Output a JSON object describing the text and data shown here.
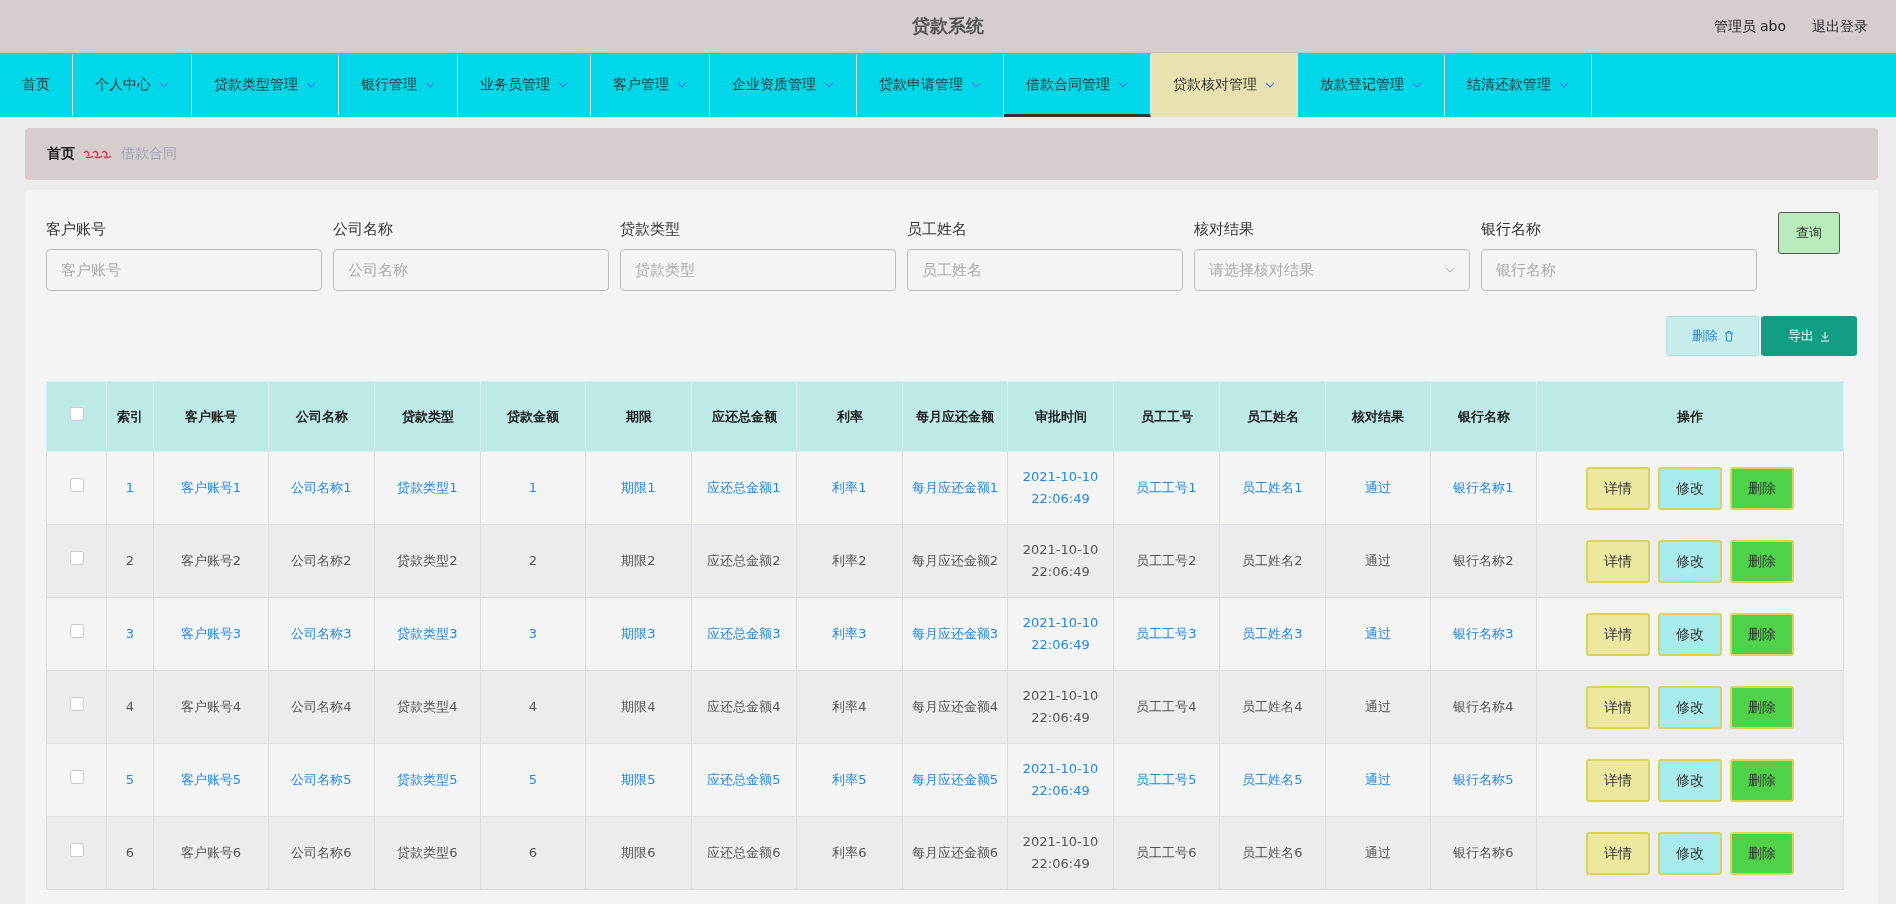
{
  "header": {
    "title": "贷款系统",
    "user": "管理员 abo",
    "logout": "退出登录"
  },
  "nav": [
    {
      "label": "首页",
      "dropdown": false,
      "selected": false,
      "hovered": false
    },
    {
      "label": "个人中心",
      "dropdown": true,
      "selected": false,
      "hovered": false
    },
    {
      "label": "贷款类型管理",
      "dropdown": true,
      "selected": false,
      "hovered": false
    },
    {
      "label": "银行管理",
      "dropdown": true,
      "selected": false,
      "hovered": false
    },
    {
      "label": "业务员管理",
      "dropdown": true,
      "selected": false,
      "hovered": false
    },
    {
      "label": "客户管理",
      "dropdown": true,
      "selected": false,
      "hovered": false
    },
    {
      "label": "企业资质管理",
      "dropdown": true,
      "selected": false,
      "hovered": false
    },
    {
      "label": "贷款申请管理",
      "dropdown": true,
      "selected": false,
      "hovered": false
    },
    {
      "label": "借款合同管理",
      "dropdown": true,
      "selected": true,
      "hovered": false
    },
    {
      "label": "贷款核对管理",
      "dropdown": true,
      "selected": false,
      "hovered": true
    },
    {
      "label": "放款登记管理",
      "dropdown": true,
      "selected": false,
      "hovered": false
    },
    {
      "label": "结清还款管理",
      "dropdown": true,
      "selected": false,
      "hovered": false
    }
  ],
  "breadcrumb": {
    "home": "首页",
    "current": "借款合同"
  },
  "filters": [
    {
      "label": "客户账号",
      "placeholder": "客户账号",
      "kind": "text"
    },
    {
      "label": "公司名称",
      "placeholder": "公司名称",
      "kind": "text"
    },
    {
      "label": "贷款类型",
      "placeholder": "贷款类型",
      "kind": "text"
    },
    {
      "label": "员工姓名",
      "placeholder": "员工姓名",
      "kind": "text"
    },
    {
      "label": "核对结果",
      "placeholder": "请选择核对结果",
      "kind": "select"
    },
    {
      "label": "银行名称",
      "placeholder": "银行名称",
      "kind": "text"
    }
  ],
  "search_button": "查询",
  "toolbar": {
    "delete": "删除",
    "export": "导出"
  },
  "table": {
    "select_all_checked": false,
    "columns": [
      "索引",
      "客户账号",
      "公司名称",
      "贷款类型",
      "贷款金额",
      "期限",
      "应还总金额",
      "利率",
      "每月应还金额",
      "审批时间",
      "员工工号",
      "员工姓名",
      "核对结果",
      "银行名称",
      "操作"
    ],
    "rows": [
      {
        "kind": "link",
        "checked": false,
        "cells": [
          "1",
          "客户账号1",
          "公司名称1",
          "贷款类型1",
          "1",
          "期限1",
          "应还总金额1",
          "利率1",
          "每月应还金额1",
          "2021-10-10 22:06:49",
          "员工工号1",
          "员工姓名1",
          "通过",
          "银行名称1"
        ],
        "actions": [
          {
            "label": "详情",
            "kind": "detail"
          },
          {
            "label": "修改",
            "kind": "edit"
          },
          {
            "label": "删除",
            "kind": "delete"
          }
        ]
      },
      {
        "kind": "plain",
        "checked": false,
        "cells": [
          "2",
          "客户账号2",
          "公司名称2",
          "贷款类型2",
          "2",
          "期限2",
          "应还总金额2",
          "利率2",
          "每月应还金额2",
          "2021-10-10 22:06:49",
          "员工工号2",
          "员工姓名2",
          "通过",
          "银行名称2"
        ],
        "actions": [
          {
            "label": "详情",
            "kind": "detail"
          },
          {
            "label": "修改",
            "kind": "edit"
          },
          {
            "label": "删除",
            "kind": "delete"
          }
        ]
      },
      {
        "kind": "link",
        "checked": false,
        "cells": [
          "3",
          "客户账号3",
          "公司名称3",
          "贷款类型3",
          "3",
          "期限3",
          "应还总金额3",
          "利率3",
          "每月应还金额3",
          "2021-10-10 22:06:49",
          "员工工号3",
          "员工姓名3",
          "通过",
          "银行名称3"
        ],
        "actions": [
          {
            "label": "详情",
            "kind": "detail"
          },
          {
            "label": "修改",
            "kind": "edit"
          },
          {
            "label": "删除",
            "kind": "delete"
          }
        ]
      },
      {
        "kind": "plain",
        "checked": false,
        "cells": [
          "4",
          "客户账号4",
          "公司名称4",
          "贷款类型4",
          "4",
          "期限4",
          "应还总金额4",
          "利率4",
          "每月应还金额4",
          "2021-10-10 22:06:49",
          "员工工号4",
          "员工姓名4",
          "通过",
          "银行名称4"
        ],
        "actions": [
          {
            "label": "详情",
            "kind": "detail"
          },
          {
            "label": "修改",
            "kind": "edit"
          },
          {
            "label": "删除",
            "kind": "delete"
          }
        ]
      },
      {
        "kind": "link",
        "checked": false,
        "cells": [
          "5",
          "客户账号5",
          "公司名称5",
          "贷款类型5",
          "5",
          "期限5",
          "应还总金额5",
          "利率5",
          "每月应还金额5",
          "2021-10-10 22:06:49",
          "员工工号5",
          "员工姓名5",
          "通过",
          "银行名称5"
        ],
        "actions": [
          {
            "label": "详情",
            "kind": "detail"
          },
          {
            "label": "修改",
            "kind": "edit"
          },
          {
            "label": "删除",
            "kind": "delete"
          }
        ]
      },
      {
        "kind": "plain",
        "checked": false,
        "cells": [
          "6",
          "客户账号6",
          "公司名称6",
          "贷款类型6",
          "6",
          "期限6",
          "应还总金额6",
          "利率6",
          "每月应还金额6",
          "2021-10-10 22:06:49",
          "员工工号6",
          "员工姓名6",
          "通过",
          "银行名称6"
        ],
        "actions": [
          {
            "label": "详情",
            "kind": "detail"
          },
          {
            "label": "修改",
            "kind": "edit"
          },
          {
            "label": "删除",
            "kind": "delete"
          }
        ]
      }
    ]
  }
}
